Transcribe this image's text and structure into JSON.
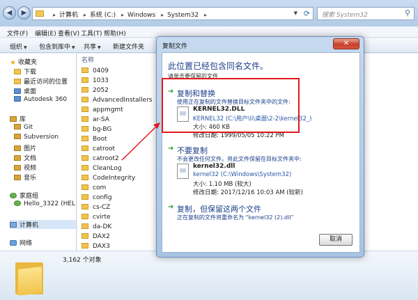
{
  "address": {
    "crumbs": [
      "计算机",
      "系统 (C:)",
      "Windows",
      "System32"
    ],
    "search_placeholder": "搜索 System32"
  },
  "menubar": [
    "文件(F)",
    "编辑(E)",
    "查看(V)",
    "工具(T)",
    "帮助(H)"
  ],
  "toolbar": {
    "organize": "组织",
    "include_in_library": "包含到库中",
    "share": "共享",
    "new_folder": "新建文件夹"
  },
  "sidebar": {
    "favorites": "收藏夹",
    "fav_items": [
      "下载",
      "最近访问的位置",
      "桌面",
      "Autodesk 360"
    ],
    "libraries": "库",
    "lib_items": [
      "Git",
      "Subversion",
      "图片",
      "文档",
      "视频",
      "音乐"
    ],
    "homegroup": "家庭组",
    "homegroup_user": "Hello_3322 (HEL",
    "computer": "计算机",
    "network": "网络"
  },
  "filelist": {
    "column_name": "名称",
    "items": [
      "0409",
      "1033",
      "2052",
      "AdvancedInstallers",
      "appmgmt",
      "ar-SA",
      "bg-BG",
      "Boot",
      "catroot",
      "catroot2",
      "CleanLog",
      "CodeIntegrity",
      "com",
      "config",
      "cs-CZ",
      "cvirte",
      "da-DK",
      "DAX2",
      "DAX3"
    ]
  },
  "details": {
    "count": "3,162 个对象"
  },
  "dialog": {
    "title": "复制文件",
    "close_label": "✕",
    "heading": "此位置已经包含同名文件。",
    "subheading": "请单击要保留的文件",
    "option1": {
      "title": "复制和替换",
      "desc": "使用正在复制的文件替换目标文件夹中的文件:",
      "filename": "KERNEL32.DLL",
      "path": "KERNEL32 (C:\\用户\\li\\桌面\\2-2\\kernel32_)",
      "size": "大小: 460 KB",
      "modified": "修改日期: 1999/05/05 10:22 PM"
    },
    "option2": {
      "title": "不要复制",
      "desc": "不会更改任何文件。将此文件保留在目标文件夹中:",
      "filename": "kernel32.dll",
      "path": "kernel32 (C:\\Windows\\System32)",
      "size": "大小: 1.10 MB (较大)",
      "modified": "修改日期: 2017/12/16 10:03 AM (较新)"
    },
    "option3": {
      "title": "复制，但保留这两个文件",
      "desc": "正在复制的文件将重命名为 “kernel32 (2).dll”"
    },
    "cancel": "取消"
  },
  "colors": {
    "highlight": "#e0181c",
    "link": "#1c3f8a",
    "arrow_green": "#2f9b37"
  }
}
